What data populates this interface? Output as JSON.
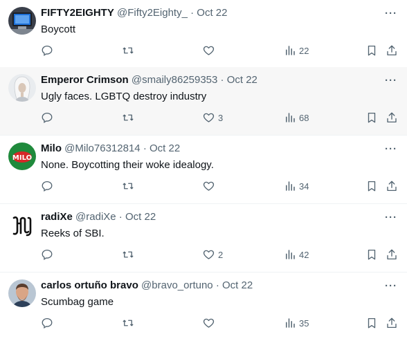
{
  "tweets": [
    {
      "name": "FIFTY2EIGHTY",
      "handle": "@Fifty2Eighty_",
      "sep": "·",
      "date": "Oct 22",
      "text": "Boycott",
      "likes": "",
      "views": "22",
      "avatar": "tv-avatar"
    },
    {
      "name": "Emperor Crimson",
      "handle": "@smaily86259353",
      "sep": "·",
      "date": "Oct 22",
      "text": "Ugly faces. LGBTQ destroy industry",
      "likes": "3",
      "views": "68",
      "avatar": "white-hair-avatar"
    },
    {
      "name": "Milo",
      "handle": "@Milo76312814",
      "sep": "·",
      "date": "Oct 22",
      "text": "None. Boycotting their woke idealogy.",
      "likes": "",
      "views": "34",
      "avatar": "milo-logo-avatar"
    },
    {
      "name": "radiXe",
      "handle": "@radiXe",
      "sep": "·",
      "date": "Oct 22",
      "text": "Reeks of SBI.",
      "likes": "2",
      "views": "42",
      "avatar": "blackletter-logo-avatar"
    },
    {
      "name": "carlos ortuño bravo",
      "handle": "@bravo_ortuno",
      "sep": "·",
      "date": "Oct 22",
      "text": "Scumbag game",
      "likes": "",
      "views": "35",
      "avatar": "man-photo-avatar"
    }
  ],
  "more_label": "···",
  "colors": {
    "muted": "#536471",
    "text": "#0f1419",
    "hover_bg": "#f7f7f7",
    "divider": "#eff3f4"
  }
}
